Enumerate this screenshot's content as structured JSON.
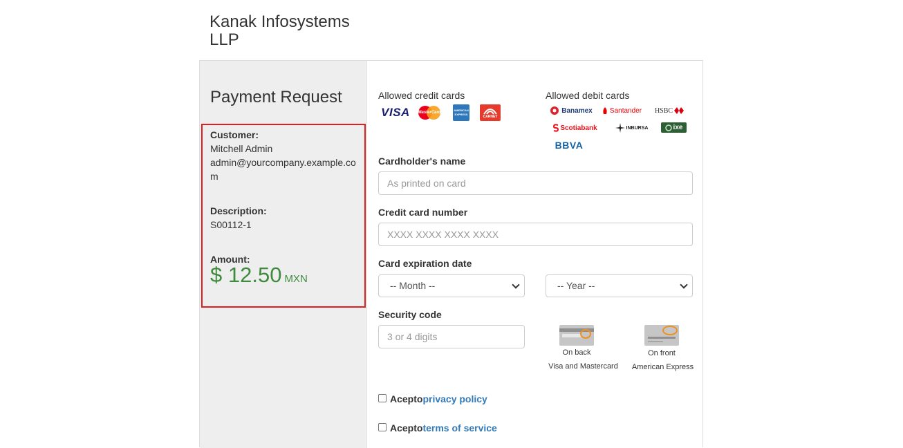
{
  "company": {
    "name": "Kanak Infosystems LLP"
  },
  "sidebar": {
    "title": "Payment Request",
    "customer_label": "Customer:",
    "customer_name": "Mitchell Admin",
    "customer_email": "admin@yourcompany.example.com",
    "description_label": "Description:",
    "description_value": "S00112-1",
    "amount_label": "Amount:",
    "amount_value": "$ 12.50",
    "currency": "MXN"
  },
  "cards": {
    "credit_title": "Allowed credit cards",
    "credit": [
      {
        "name": "VISA",
        "icon": "visa-logo",
        "color": "#1a1f71"
      },
      {
        "name": "MasterCard",
        "icon": "mastercard-logo",
        "color": "#eb001b"
      },
      {
        "name": "AMERICAN EXPRESS",
        "icon": "amex-logo",
        "color": "#2e77bb"
      },
      {
        "name": "CARNET",
        "icon": "carnet-logo",
        "color": "#e53b2c"
      }
    ],
    "debit_title": "Allowed debit cards",
    "debit": [
      {
        "name": "Banamex",
        "icon": "banamex-logo",
        "color": "#1d3b78"
      },
      {
        "name": "Santander",
        "icon": "santander-logo",
        "color": "#ec0000"
      },
      {
        "name": "HSBC",
        "icon": "hsbc-logo",
        "color": "#db0011"
      },
      {
        "name": "Scotiabank",
        "icon": "scotiabank-logo",
        "color": "#ec111a"
      },
      {
        "name": "INBURSA",
        "icon": "inbursa-logo",
        "color": "#1a1a1a"
      },
      {
        "name": "ixe",
        "icon": "ixe-logo",
        "color": "#2e7d32"
      },
      {
        "name": "BBVA",
        "icon": "bbva-logo",
        "color": "#1464a5"
      }
    ]
  },
  "form": {
    "name_label": "Cardholder's name",
    "name_placeholder": "As printed on card",
    "number_label": "Credit card number",
    "number_placeholder": "XXXX XXXX XXXX XXXX",
    "expiration_label": "Card expiration date",
    "month_value": "-- Month --",
    "year_value": "-- Year --",
    "security_label": "Security code",
    "security_placeholder": "3 or 4 digits",
    "back_caption_1": "On back",
    "back_caption_2": "Visa and Mastercard",
    "front_caption_1": "On front",
    "front_caption_2": "American Express"
  },
  "agreements": {
    "privacy_prefix": "Acepto",
    "privacy_link": "privacy policy",
    "terms_prefix": "Acepto",
    "terms_link": "terms of service"
  },
  "colors": {
    "amount": "#3f8a3f",
    "link": "#337ab7",
    "highlight_border": "#dd1f1f"
  }
}
